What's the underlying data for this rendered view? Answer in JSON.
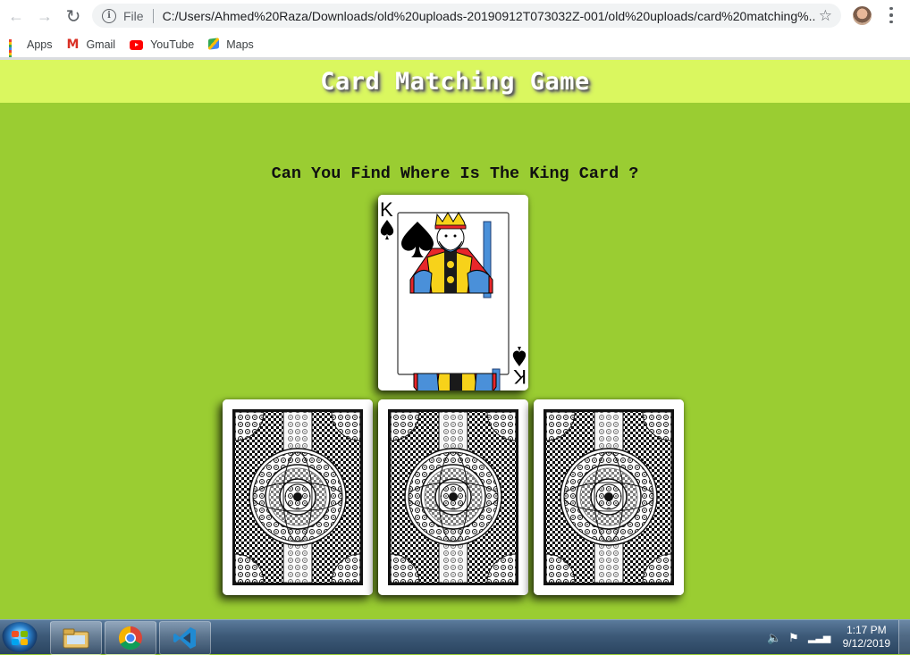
{
  "browser": {
    "url_scheme": "File",
    "url": "C:/Users/Ahmed%20Raza/Downloads/old%20uploads-20190912T073032Z-001/old%20uploads/card%20matching%...",
    "bookmarks": [
      {
        "label": "Apps",
        "icon": "apps-grid-icon"
      },
      {
        "label": "Gmail",
        "icon": "gmail-icon"
      },
      {
        "label": "YouTube",
        "icon": "youtube-icon"
      },
      {
        "label": "Maps",
        "icon": "maps-icon"
      }
    ]
  },
  "page": {
    "title": "Card Matching Game",
    "question": "Can You Find Where Is The King Card ?",
    "revealed_card": {
      "rank": "K",
      "suit": "spades"
    },
    "hidden_cards": 3,
    "colors": {
      "background": "#9acd32",
      "header": "#daf75f"
    }
  },
  "taskbar": {
    "pinned_apps": [
      "file-explorer",
      "google-chrome",
      "visual-studio-code"
    ],
    "time": "1:17 PM",
    "date": "9/12/2019"
  }
}
